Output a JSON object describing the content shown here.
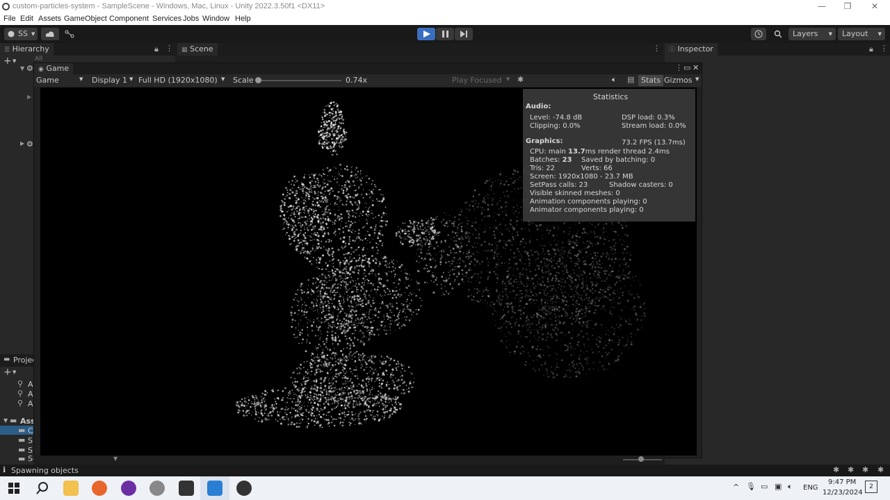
{
  "window": {
    "title": "custom-particles-system - SampleScene - Windows, Mac, Linux - Unity 2022.3.50f1 <DX11>",
    "minimize": "—",
    "maximize": "❐",
    "close": "✕"
  },
  "menu": [
    "File",
    "Edit",
    "Assets",
    "GameObject",
    "Component",
    "Services",
    "Jobs",
    "Window",
    "Help"
  ],
  "toolbar": {
    "account": "SS",
    "layers": "Layers",
    "layout": "Layout"
  },
  "tabs": {
    "hierarchy": "Hierarchy",
    "scene": "Scene",
    "inspector": "Inspector",
    "game": "Game",
    "project": "Projec",
    "hierarchy_search": "All"
  },
  "game_toolbar": {
    "mode": "Game",
    "display": "Display 1",
    "resolution": "Full HD (1920x1080)",
    "scale_label": "Scale",
    "scale_value": "0.74x",
    "play_focused": "Play Focused",
    "stats": "Stats",
    "gizmos": "Gizmos"
  },
  "statistics": {
    "title": "Statistics",
    "audio_header": "Audio:",
    "level": "Level: -74.8 dB",
    "clipping": "Clipping: 0.0%",
    "dsp_load": "DSP load: 0.3%",
    "stream_load": "Stream load: 0.0%",
    "graphics_header": "Graphics:",
    "fps": "73.2 FPS (13.7ms)",
    "cpu_main_label": "CPU: main ",
    "cpu_main_value": "13.7",
    "cpu_main_rest": "ms  render thread 2.4ms",
    "batches_label": "Batches: ",
    "batches_value": "23",
    "saved_by_batching": "Saved by batching: 0",
    "tris": "Tris: 22",
    "verts": "Verts: 66",
    "screen": "Screen: 1920x1080 - 23.7 MB",
    "setpass": "SetPass calls: 23",
    "shadow_casters": "Shadow casters: 0",
    "skinned": "Visible skinned meshes: 0",
    "animation": "Animation components playing: 0",
    "animator": "Animator components playing: 0"
  },
  "project": {
    "search_items": [
      "Al",
      "Al",
      "Al"
    ],
    "assets_label": "Ass",
    "folders": [
      "C",
      "S",
      "S"
    ],
    "settings": "Settings"
  },
  "status": {
    "message": "Spawning objects"
  },
  "taskbar": {
    "language": "ENG",
    "time": "9:47 PM",
    "date": "12/23/2024",
    "notifications": "2"
  }
}
